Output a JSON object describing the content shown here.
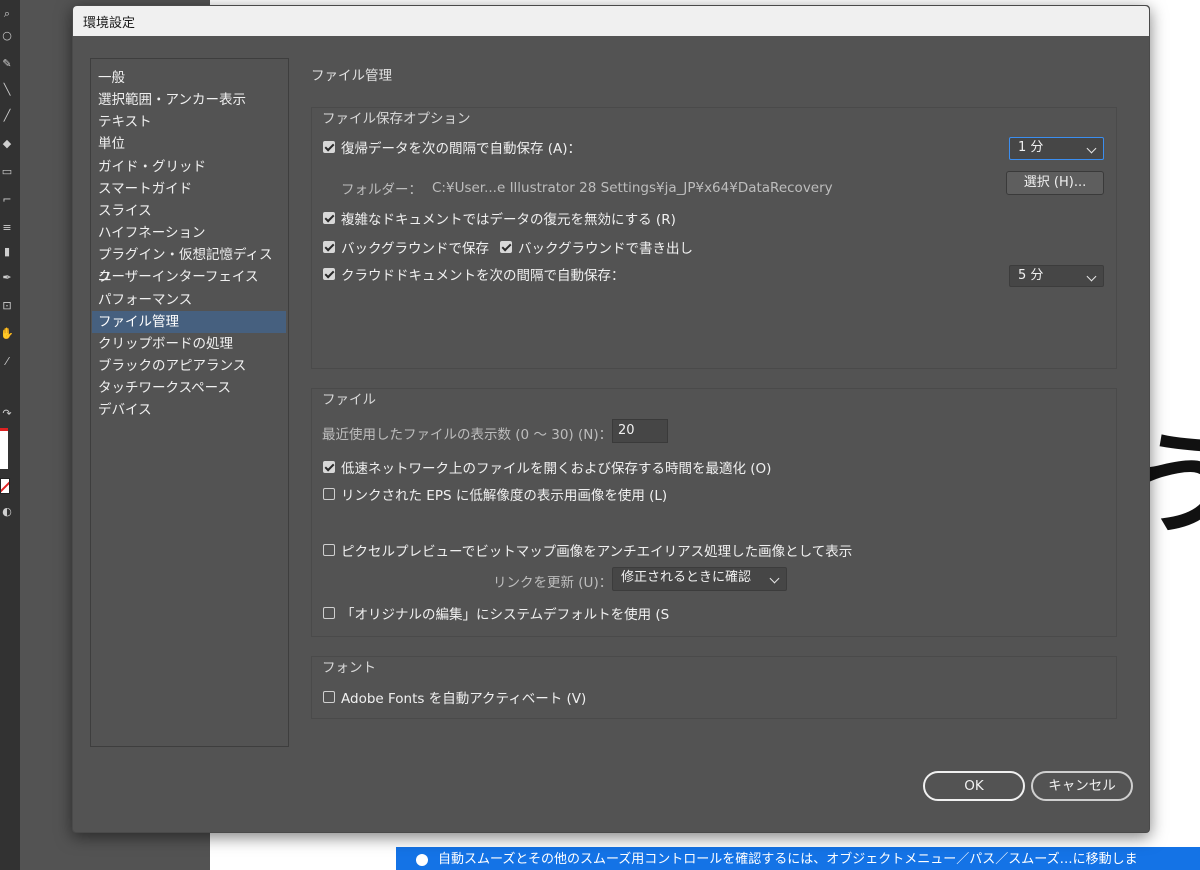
{
  "dialog": {
    "title": "環境設定",
    "page_title": "ファイル管理"
  },
  "sidebar": {
    "items": [
      {
        "label": "一般"
      },
      {
        "label": "選択範囲・アンカー表示"
      },
      {
        "label": "テキスト"
      },
      {
        "label": "単位"
      },
      {
        "label": "ガイド・グリッド"
      },
      {
        "label": "スマートガイド"
      },
      {
        "label": "スライス"
      },
      {
        "label": "ハイフネーション"
      },
      {
        "label": "プラグイン・仮想記憶ディスク"
      },
      {
        "label": "ユーザーインターフェイス"
      },
      {
        "label": "パフォーマンス"
      },
      {
        "label": "ファイル管理",
        "selected": true
      },
      {
        "label": "クリップボードの処理"
      },
      {
        "label": "ブラックのアピアランス"
      },
      {
        "label": "タッチワークスペース"
      },
      {
        "label": "デバイス"
      }
    ]
  },
  "save_options": {
    "group_label": "ファイル保存オプション",
    "autosave_label": "復帰データを次の間隔で自動保存 (A)：",
    "autosave_checked": true,
    "autosave_interval": "1 分",
    "folder_label": "フォルダー：",
    "folder_path": "C:¥User...e Illustrator 28 Settings¥ja_JP¥x64¥DataRecovery",
    "choose_button": "選択 (H)...",
    "disable_recovery_label": "複雑なドキュメントではデータの復元を無効にする (R)",
    "disable_recovery_checked": true,
    "background_save_label": "バックグラウンドで保存",
    "background_save_checked": true,
    "background_export_label": "バックグラウンドで書き出し",
    "background_export_checked": true,
    "cloud_autosave_label": "クラウドドキュメントを次の間隔で自動保存：",
    "cloud_autosave_checked": true,
    "cloud_interval": "5 分"
  },
  "files": {
    "group_label": "ファイル",
    "recent_count_label": "最近使用したファイルの表示数 (0 ～ 30) (N)：",
    "recent_count_value": "20",
    "optimize_network_label": "低速ネットワーク上のファイルを開くおよび保存する時間を最適化 (O)",
    "optimize_network_checked": true,
    "low_res_eps_label": "リンクされた EPS に低解像度の表示用画像を使用 (L)",
    "low_res_eps_checked": false,
    "pixel_preview_label": "ピクセルプレビューでビットマップ画像をアンチエイリアス処理した画像として表示",
    "pixel_preview_checked": false,
    "update_links_label": "リンクを更新 (U)：",
    "update_links_value": "修正されるときに確認",
    "edit_original_label": "「オリジナルの編集」にシステムデフォルトを使用 (S",
    "edit_original_checked": false
  },
  "fonts": {
    "group_label": "フォント",
    "adobe_fonts_label": "Adobe Fonts を自動アクティベート (V)",
    "adobe_fonts_checked": false
  },
  "buttons": {
    "ok": "OK",
    "cancel": "キャンセル"
  },
  "background": {
    "status_message": "自動スムーズとその他のスムーズ用コントロールを確認するには、オブジェクトメニュー／パス／スムーズ…に移動しま",
    "canvas_glyph": "う"
  }
}
